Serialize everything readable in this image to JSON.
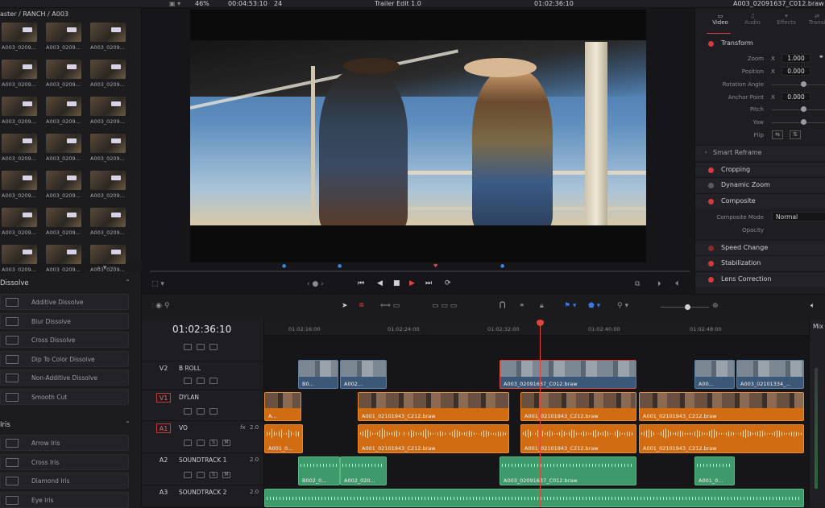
{
  "topbar": {
    "media_path": "aster / RANCH / A003",
    "zoom": "46%",
    "timecode_duration": "00:04:53:10",
    "fps": "24",
    "timeline_name": "Trailer Edit 1.0",
    "viewer_timecode": "01:02:36:10",
    "clip_name": "A003_02091637_C012.braw"
  },
  "media_pool": {
    "thumbs": [
      "A003_0209...",
      "A003_0209...",
      "A003_0209...",
      "A003_0209...",
      "A003_0209...",
      "A003_0209...",
      "A003_0209...",
      "A003_0209...",
      "A003_0209...",
      "A003_0209...",
      "A003_0209...",
      "A003_0209...",
      "A003_0209...",
      "A003_0209...",
      "A003_0209...",
      "A003_0209...",
      "A003_0209...",
      "A003_0209...",
      "A003_0209...",
      "A003_0209...",
      "A003_0209..."
    ]
  },
  "effects": {
    "dissolve_header": "Dissolve",
    "dissolves": [
      "Additive Dissolve",
      "Blur Dissolve",
      "Cross Dissolve",
      "Dip To Color Dissolve",
      "Non-Additive Dissolve",
      "Smooth Cut"
    ],
    "iris_header": "Iris",
    "iris": [
      "Arrow Iris",
      "Cross Iris",
      "Diamond Iris",
      "Eye Iris"
    ]
  },
  "inspector": {
    "tabs": [
      "Video",
      "Audio",
      "Effects",
      "Transi"
    ],
    "transform": "Transform",
    "params": {
      "zoom_label": "Zoom",
      "zoom_x": "1.000",
      "position_label": "Position",
      "position_x": "0.000",
      "rotation_label": "Rotation Angle",
      "anchor_label": "Anchor Point",
      "anchor_x": "0.000",
      "pitch_label": "Pitch",
      "yaw_label": "Yaw",
      "flip_label": "Flip",
      "x": "X"
    },
    "smart_reframe": "Smart Reframe",
    "cropping": "Cropping",
    "dynamic_zoom": "Dynamic Zoom",
    "composite": "Composite",
    "composite_mode_label": "Composite Mode",
    "composite_mode": "Normal",
    "opacity_label": "Opacity",
    "speed_change": "Speed Change",
    "stabilization": "Stabilization",
    "lens_correction": "Lens Correction"
  },
  "timeline": {
    "timecode": "01:02:36:10",
    "ruler": [
      "01:02:16:00",
      "01:02:24:00",
      "01:02:32:00",
      "01:02:40:00",
      "01:02:48:00"
    ],
    "mixer_label": "Mix",
    "tracks": [
      {
        "id": "V2",
        "name": "B ROLL"
      },
      {
        "id": "V1",
        "name": "DYLAN"
      },
      {
        "id": "A1",
        "name": "VO",
        "level": "2.0",
        "fx": "fx"
      },
      {
        "id": "A2",
        "name": "SOUNDTRACK 1",
        "level": "2.0"
      },
      {
        "id": "A3",
        "name": "SOUNDTRACK 2",
        "level": "2.0"
      }
    ],
    "clips": {
      "v2": [
        "B0...",
        "A002...",
        "A003_02091637_C012.braw",
        "A00...",
        "A003_02101334_..."
      ],
      "v1": [
        "A...",
        "A001_02101943_C212.braw",
        "A001_02101943_C212.braw",
        "A001_02101943_C212.braw"
      ],
      "a1": [
        "A001_0...",
        "A001_02101943_C212.braw",
        "A001_02101943_C212.braw",
        "A001_02101943_C212.braw"
      ],
      "a2": [
        "B002_0...",
        "A002_020...",
        "A003_02091637_C012.braw",
        "A001_0..."
      ]
    }
  }
}
